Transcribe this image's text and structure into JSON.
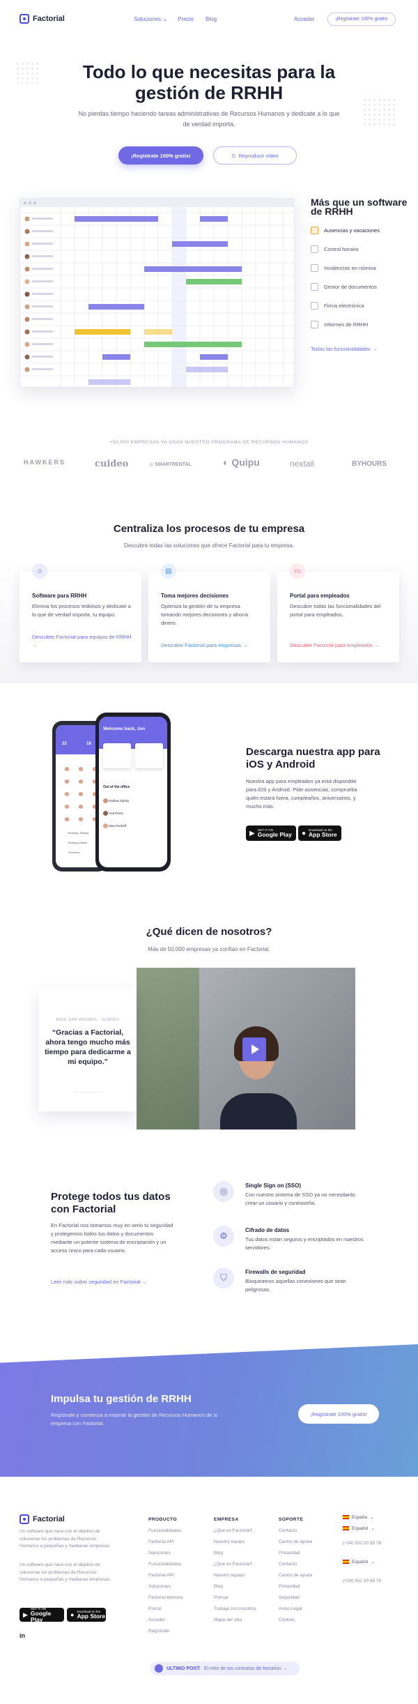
{
  "nav": {
    "logo": "Factorial",
    "links": [
      "Soluciones",
      "Precio",
      "Blog"
    ],
    "login": "Acceder",
    "cta": "¡Regístrate 100% gratis!"
  },
  "hero": {
    "title": "Todo lo que necesitas para la gestión de RRHH",
    "subtitle": "No pierdas tiempo haciendo tareas administrativas de Recursos Humanos y dedícate a lo que de verdad importa.",
    "primary_button": "¡Regístrate 100% gratis!",
    "video_button": "Reproducir vídeo"
  },
  "features_sidebar": {
    "title": "Más que un software de RRHH",
    "items": [
      "Ausencias y vacaciones",
      "Control horario",
      "Incidencias en nómina",
      "Gestor de documentos",
      "Firma electrónica",
      "Informes de RRHH"
    ],
    "link": "Todas las funcionalidades →"
  },
  "logos": {
    "caption": "+50.000 EMPRESAS YA USAN NUESTRO PROGRAMA DE RECURSOS HUMANOS",
    "brands": [
      "HAWKERS",
      "cuideo",
      "SMARTRENTAL",
      "Quipu",
      "nextail",
      "BYHOURS"
    ]
  },
  "centraliza": {
    "title": "Centraliza los procesos de tu empresa",
    "subtitle": "Descubre todas las soluciones que ofrece Factorial para tu empresa.",
    "cards": [
      {
        "title": "Software para RRHH",
        "text": "Elimina los procesos tediosos y dedícate a lo que de verdad importa, tu equipo.",
        "link": "Descubre Factorial para equipos de RRHH →",
        "color": "#7069e6"
      },
      {
        "title": "Toma mejores decisiones",
        "text": "Optimiza la gestión de tu empresa tomando mejores decisiones y ahorra dinero.",
        "link": "Descubre Factorial para empresas →",
        "color": "#4a90d9"
      },
      {
        "title": "Portal para empleados",
        "text": "Descubre todas las funcionalidades del portal para empleados.",
        "link": "Descubre Factorial para empleados →",
        "color": "#e5677a"
      }
    ]
  },
  "app": {
    "title": "Descarga nuestra app para iOS y Android",
    "text": "Nuestra app para empleados ya está disponible para iOS y Android. Pide ausencias, comprueba quién estará fuera, cumpleaños, aniversarios, y mucho más.",
    "google": {
      "small": "GET IT ON",
      "big": "Google Play"
    },
    "apple": {
      "small": "Download on the",
      "big": "App Store"
    },
    "phone": {
      "welcome": "Welcome back, Jon",
      "out_label": "Out of the office",
      "names": [
        "Andrea Carrey",
        "Ana Pérez",
        "Max Puckoff"
      ],
      "back_days": [
        "22",
        "18"
      ],
      "back_names": [
        "Booking Jessica",
        "Booking Daniel",
        "Producer"
      ]
    }
  },
  "testimonials": {
    "title": "¿Qué dicen de nosotros?",
    "subtitle": "Más de 50.000 empresas ya confían en Factorial.",
    "meta": "ENID SAN ANDRÉS · GUIDEO",
    "quote": "“Gracias a Factorial, ahora tengo mucho más tiempo para dedicarme a mi equipo.”"
  },
  "security": {
    "title": "Protege todos tus datos con Factorial",
    "text": "En Factorial nos tomamos muy en serio tu seguridad y protegemos todos tus datos y documentos mediante un potente sistema de encriptación y un acceso único para cada usuario.",
    "link": "Leer más sobre seguridad en Factorial →",
    "features": [
      {
        "title": "Single Sign on (SSO)",
        "text": "Con nuestro sistema de SSO ya no necesitarás crear un usuario y contraseña.",
        "icon": "fingerprint-icon"
      },
      {
        "title": "Cifrado de datos",
        "text": "Tus datos están seguros y encriptados en nuestros servidores.",
        "icon": "encryption-icon"
      },
      {
        "title": "Firewalls de seguridad",
        "text": "Bloqueamos aquellas conexiones que sean peligrosas.",
        "icon": "shield-icon"
      }
    ]
  },
  "cta": {
    "title": "Impulsa tu gestión de RRHH",
    "text": "Regístrate y comienza a mejorar la gestión de Recursos Humanos de tu empresa con Factorial.",
    "button": "¡Regístrate 100% gratis!"
  },
  "footer": {
    "logo": "Factorial",
    "desc1": "Un software que nace con el objetivo de solucionar los problemas de Recursos Humanos a pequeñas y medianas empresas.",
    "desc2": "Un software que nace con el objetivo de solucionar los problemas de Recursos Humanos a pequeñas y medianas empresas.",
    "columns": [
      {
        "title": "PRODUCTO",
        "items": [
          "Funcionalidades",
          "Factorial API",
          "Soluciones",
          "Funcionalidades",
          "Factorial API",
          "Soluciones",
          "Factorial Nomina",
          "Precio",
          "Acceder",
          "Regístrate"
        ]
      },
      {
        "title": "EMPRESA",
        "items": [
          "¿Qué es Factorial?",
          "Nuestro equipo",
          "Blog",
          "¿Qué es Factorial?",
          "Nuestro equipo",
          "Blog",
          "Prensa",
          "Trabaja con nosotros",
          "Mapa del sitio"
        ]
      },
      {
        "title": "SOPORTE",
        "items": [
          "Contacto",
          "Centro de ayuda",
          "Privacidad",
          "Contacto",
          "Centro de ayuda",
          "Privacidad",
          "Seguridad",
          "Aviso Legal",
          "Cookies"
        ]
      }
    ],
    "lang1": "España",
    "lang2": "Español",
    "phone1": "(+34) 932 20 59 76",
    "lang3": "Español",
    "phone2": "(+34) 932 20 59 76",
    "linkedin": "in",
    "post_label": "ULTIMO POST:",
    "post_text": "El mito de los contratos de becarios →"
  }
}
